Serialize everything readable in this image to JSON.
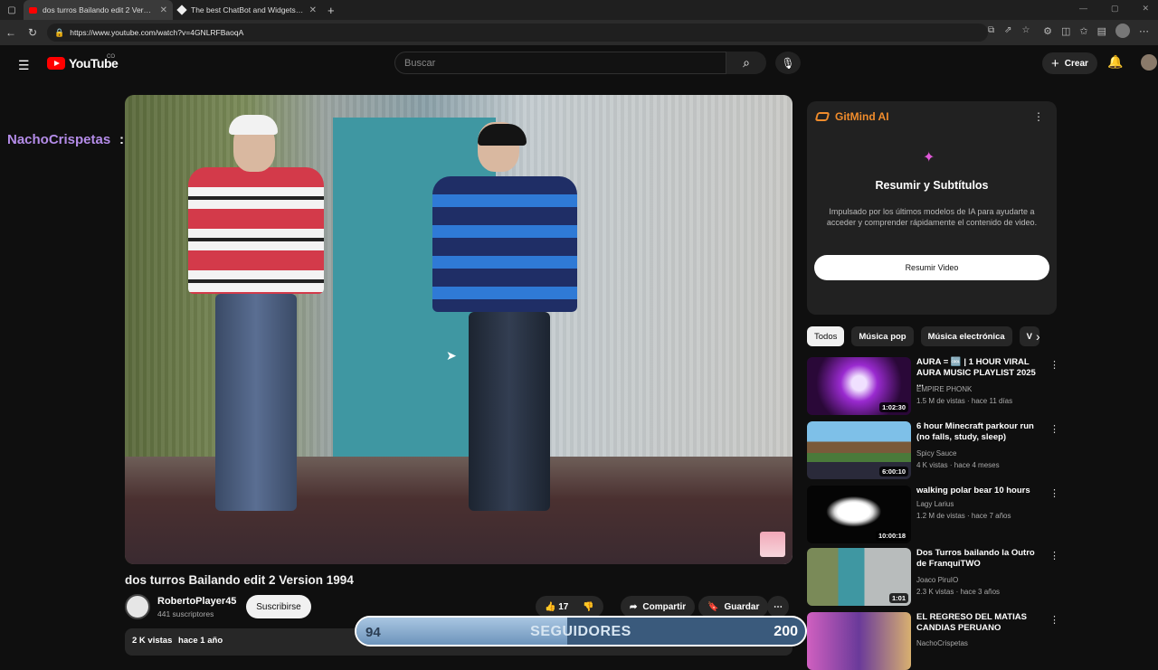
{
  "browser": {
    "tabs": [
      {
        "title": "dos turros Bailando edit 2 Version",
        "active": true
      },
      {
        "title": "The best ChatBot and Widgets fo",
        "active": false
      }
    ],
    "url": "https://www.youtube.com/watch?v=4GNLRFBaoqA"
  },
  "header": {
    "logo": "YouTube",
    "logo_suffix": "CO",
    "search_placeholder": "Buscar",
    "create_label": "Crear"
  },
  "stream_overlay": {
    "username": "NachoCrispetas",
    "colon": ":",
    "followers": {
      "current": "94",
      "label": "SEGUIDORES",
      "goal": "200",
      "progress": 0.47
    }
  },
  "video": {
    "title": "dos turros Bailando edit 2 Version 1994",
    "channel": "RobertoPlayer45",
    "subscribers": "441 suscriptores",
    "subscribe_label": "Suscribirse",
    "likes": "17",
    "share_label": "Compartir",
    "save_label": "Guardar",
    "views": "2 K vistas",
    "date": "hace 1 año"
  },
  "gitmind": {
    "brand": "GitMind AI",
    "title": "Resumir y Subtítulos",
    "description": "Impulsado por los últimos modelos de IA para ayudarte a acceder y comprender rápidamente el contenido de video.",
    "button": "Resumir Video"
  },
  "chips": [
    "Todos",
    "Música pop",
    "Música electrónica",
    "V"
  ],
  "recommendations": [
    {
      "title": "AURA = 🆒 | 1 HOUR VIRAL AURA MUSIC PLAYLIST 2025 ...",
      "channel": "EMPIRE PHONK",
      "meta": "1.5 M de vistas · hace 11 días",
      "duration": "1:02:30"
    },
    {
      "title": "6 hour Minecraft parkour run (no falls, study, sleep)",
      "channel": "Spicy Sauce",
      "meta": "4 K vistas · hace 4 meses",
      "duration": "6:00:10"
    },
    {
      "title": "walking polar bear 10 hours",
      "channel": "Lagy Larius",
      "meta": "1.2 M de vistas · hace 7 años",
      "duration": "10:00:18"
    },
    {
      "title": "Dos Turros bailando la Outro de FranquiTWO",
      "channel": "Joaco PiruIO",
      "meta": "2.3 K vistas · hace 3 años",
      "duration": "1:01"
    },
    {
      "title": "EL REGRESO DEL MATIAS CANDIAS PERUANO",
      "channel": "NachoCrispetas",
      "meta": "",
      "duration": ""
    }
  ]
}
